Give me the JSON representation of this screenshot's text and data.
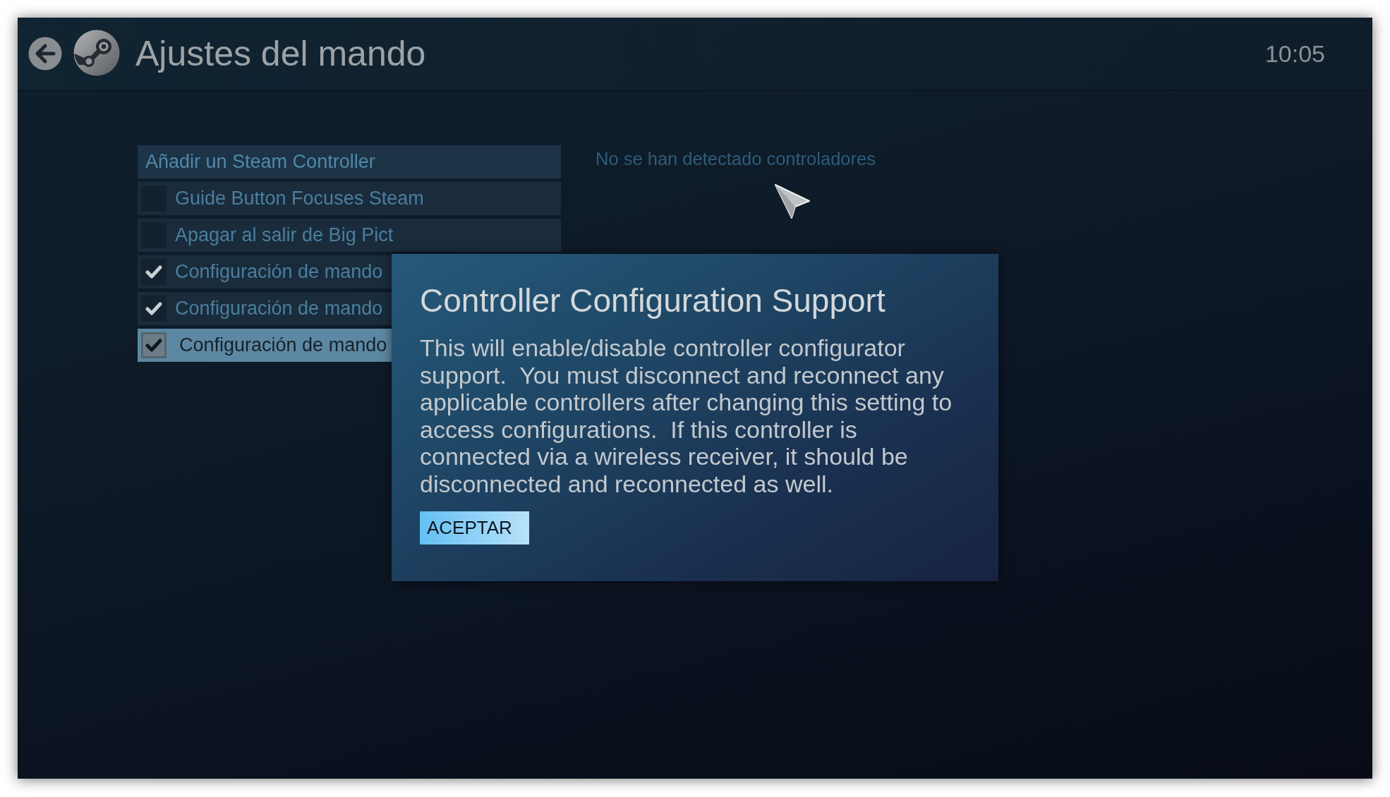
{
  "header": {
    "title": "Ajustes del mando",
    "time": "10:05"
  },
  "settings": {
    "items": [
      {
        "kind": "button",
        "label": "Añadir un Steam Controller",
        "selected": false
      },
      {
        "kind": "checkbox",
        "label": "Guide Button Focuses Steam",
        "checked": false,
        "selected": false
      },
      {
        "kind": "checkbox",
        "label": "Apagar al salir de Big Pict",
        "checked": false,
        "selected": false
      },
      {
        "kind": "checkbox",
        "label": "Configuración de mando",
        "checked": true,
        "selected": false
      },
      {
        "kind": "checkbox",
        "label": "Configuración de mando",
        "checked": true,
        "selected": false
      },
      {
        "kind": "checkbox",
        "label": "Configuración de mando",
        "checked": true,
        "selected": true
      }
    ]
  },
  "status_message": "No se han detectado controladores",
  "dialog": {
    "title": "Controller Configuration Support",
    "message": "This will enable/disable controller configurator support.  You must disconnect and reconnect any applicable controllers after changing this setting to access configurations.  If this controller is connected via a wireless receiver, it should be disconnected and reconnected as well.",
    "button": "ACEPTAR"
  }
}
